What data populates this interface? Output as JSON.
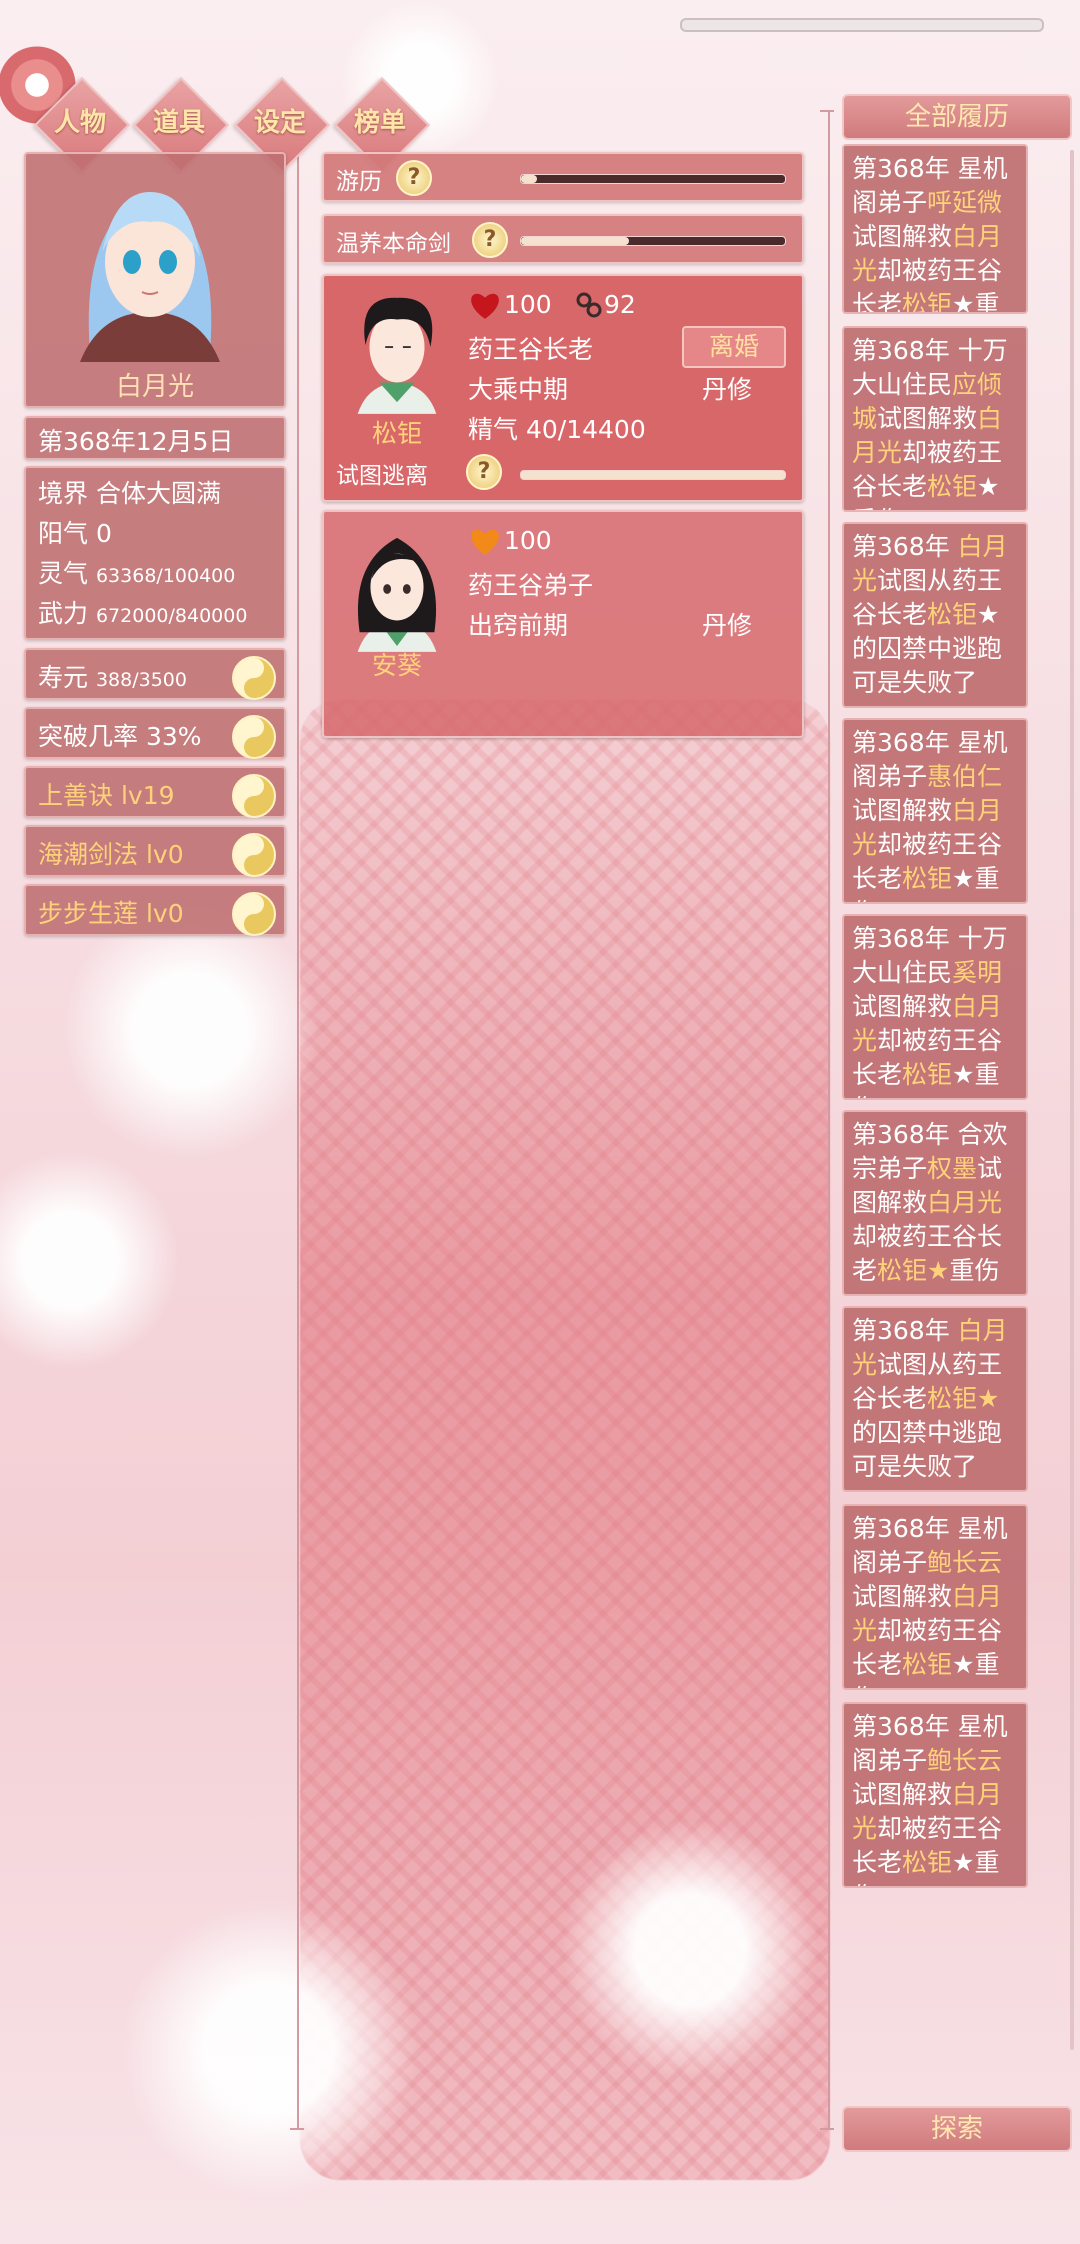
{
  "nav": {
    "tabs": [
      "人物",
      "道具",
      "设定",
      "榜单"
    ]
  },
  "player": {
    "name": "白月光",
    "date": "第368年12月5日",
    "stats": {
      "realm_label": "境界",
      "realm_value": "合体大圆满",
      "yang_label": "阳气",
      "yang_value": "0",
      "lingqi_label": "灵气",
      "lingqi_value": "63368/100400",
      "wuli_label": "武力",
      "wuli_value": "672000/840000"
    },
    "lifespan_label": "寿元",
    "lifespan_value": "388/3500",
    "breakthrough_label": "突破几率",
    "breakthrough_value": "33%",
    "skills": [
      "上善诀 lv19",
      "海潮剑法 lv0",
      "步步生莲 lv0"
    ]
  },
  "actions": {
    "travel_label": "游历",
    "travel_progress": 0.06,
    "nurture_label": "温养本命剑",
    "nurture_progress": 0.41,
    "escape_label": "试图逃离",
    "escape_progress": 0.0
  },
  "partners": [
    {
      "name": "松钜",
      "affection": "100",
      "bond": "92",
      "title": "药王谷长老",
      "realm": "大乘中期",
      "cult_type": "丹修",
      "essence_label": "精气",
      "essence_value": "40/14400",
      "divorce_label": "离婚",
      "heart_color": "#c4161c"
    },
    {
      "name": "安葵",
      "affection": "100",
      "title": "药王谷弟子",
      "realm": "出窍前期",
      "cult_type": "丹修",
      "heart_color": "#f28a1a"
    }
  ],
  "history": {
    "button_label": "全部履历",
    "entries": [
      [
        "第368年 星机阁弟子",
        "呼延微",
        "试图解救",
        "白月光",
        "却被药王谷长老",
        "松钜",
        "★重伤"
      ],
      [
        "第368年 十万大山住民",
        "应倾城",
        "试图解救",
        "白月光",
        "却被药王谷长老",
        "松钜",
        "★重伤"
      ],
      [
        "第368年 ",
        "白月光",
        "试图从药王谷长老",
        "松钜",
        "★的囚禁中逃跑可是失败了",
        "",
        ""
      ],
      [
        "第368年 星机阁弟子",
        "惠伯仁",
        "试图解救",
        "白月光",
        "却被药王谷长老",
        "松钜",
        "★重伤"
      ],
      [
        "第368年 十万大山住民",
        "奚明",
        "试图解救",
        "白月光",
        "却被药王谷长老",
        "松钜",
        "★重伤"
      ],
      [
        "第368年 合欢宗弟子",
        "权墨",
        "试图解救",
        "白月光",
        "却被药王谷长老",
        "松钜★",
        "重伤"
      ],
      [
        "第368年 ",
        "白月光",
        "试图从药王谷长老",
        "松钜★",
        "的囚禁中逃跑可是失败了",
        "",
        ""
      ],
      [
        "第368年 星机阁弟子",
        "鲍长云",
        "试图解救",
        "白月光",
        "却被药王谷长老",
        "松钜",
        "★重伤"
      ],
      [
        "第368年 星机阁弟子",
        "鲍长云",
        "试图解救",
        "白月光",
        "却被药王谷长老",
        "松钜",
        "★重伤"
      ]
    ],
    "explore_label": "探索"
  },
  "colors": {
    "panel": "#be6e70",
    "highlight": "#ffd27a",
    "button_text": "#ffe7b0"
  }
}
